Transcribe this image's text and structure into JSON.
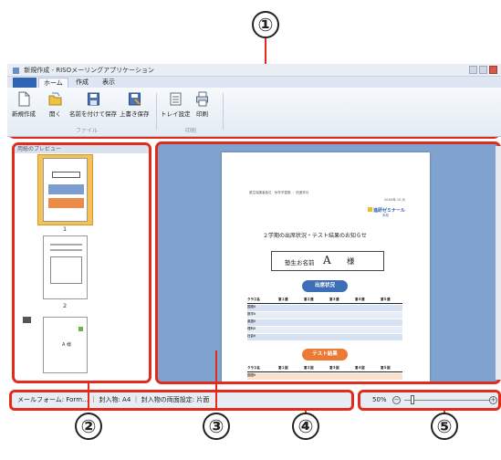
{
  "window": {
    "title": "新規作成 - RISOメーリングアプリケーション"
  },
  "ribbon": {
    "tabs": [
      {
        "label": "ホーム",
        "active": true
      },
      {
        "label": "作成",
        "active": false
      },
      {
        "label": "表示",
        "active": false
      }
    ],
    "groups": {
      "file": {
        "label": "ファイル",
        "buttons": [
          {
            "label": "新規作成",
            "icon": "new-document-icon"
          },
          {
            "label": "開く",
            "icon": "open-folder-icon"
          },
          {
            "label": "名前を付けて保存",
            "icon": "save-as-icon"
          },
          {
            "label": "上書き保存",
            "icon": "overwrite-save-icon"
          }
        ]
      },
      "print": {
        "label": "印刷",
        "buttons": [
          {
            "label": "トレイ設定",
            "icon": "tray-settings-icon"
          },
          {
            "label": "印刷",
            "icon": "printer-icon"
          }
        ]
      }
    }
  },
  "thumbnails": {
    "pane_title": "用紙のプレビュー",
    "pages": [
      {
        "number": "1",
        "selected": true
      },
      {
        "number": "2",
        "selected": false
      },
      {
        "number": "",
        "selected": false
      }
    ],
    "envelope_text": "A 様"
  },
  "document": {
    "header_left": "塾生保護者各位　秋冬学習塾 ・ 西進学月",
    "date": "20XX年 10 月",
    "logo_text": "進研ゼミナール",
    "logo_sub": "本校",
    "heading": "２学期の出席状況・テスト結果のお知らせ",
    "recipient_label": "塾生お名前",
    "recipient_name": "A",
    "recipient_suffix": "様",
    "attendance_pill": "出席状況",
    "attendance_headers": [
      "クラス名",
      "第１週",
      "第２週",
      "第３週",
      "第４週",
      "第５週"
    ],
    "attendance_rows": [
      "国語Ⅱ",
      "数学Ⅱ",
      "英語Ⅱ",
      "理科Ⅱ",
      "社会Ⅱ"
    ],
    "test_pill": "テスト結果",
    "test_headers": [
      "クラス名",
      "第１回",
      "第２回",
      "第３回",
      "第４回",
      "第５回"
    ],
    "test_rows": [
      "国語Ⅱ"
    ]
  },
  "statusbar": {
    "text": "メールフォーム: Form… ｜ 封入物: A4 ｜ 封入物の両面設定: 片面"
  },
  "zoom": {
    "level": "50%",
    "minus": "−",
    "plus": "+",
    "slider_fraction": 0.1
  },
  "callouts": [
    "①",
    "②",
    "③",
    "④",
    "⑤"
  ],
  "colors": {
    "accent_red": "#e22b1b",
    "preview_bg": "#7fa2cf",
    "pill_blue": "#3d6fb6",
    "pill_orange": "#ec7a34"
  }
}
